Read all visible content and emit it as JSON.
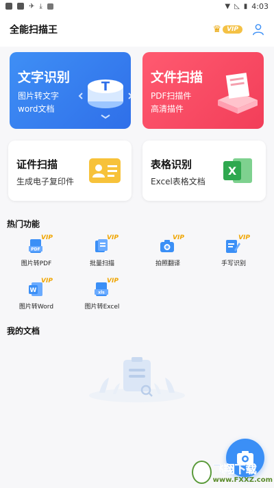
{
  "status": {
    "time": "4:03"
  },
  "app": {
    "title": "全能扫描王",
    "vip_label": "VIP"
  },
  "cards": {
    "text_recognition": {
      "title": "文字识别",
      "line1": "图片转文字",
      "line2": "word文档"
    },
    "file_scan": {
      "title": "文件扫描",
      "line1": "PDF扫描件",
      "line2": "高清描件"
    },
    "id_scan": {
      "title": "证件扫描",
      "subtitle": "生成电子复印件"
    },
    "table_recognition": {
      "title": "表格识别",
      "subtitle": "Excel表格文档"
    }
  },
  "hot": {
    "title": "热门功能",
    "items": [
      {
        "label": "图片转PDF",
        "vip": "VIP",
        "icon": "pdf-icon"
      },
      {
        "label": "批量扫描",
        "vip": "VIP",
        "icon": "batch-scan-icon"
      },
      {
        "label": "拍照翻译",
        "vip": "VIP",
        "icon": "camera-translate-icon"
      },
      {
        "label": "手写识别",
        "vip": "VIP",
        "icon": "handwriting-icon"
      },
      {
        "label": "图片转Word",
        "vip": "VIP",
        "icon": "word-icon"
      },
      {
        "label": "图片转Excel",
        "vip": "VIP",
        "icon": "excel-icon"
      }
    ]
  },
  "docs": {
    "title": "我的文档"
  },
  "watermark": {
    "main": "飞翔下载",
    "sub": "www.FXXZ.com"
  },
  "colors": {
    "primary": "#3b8ff6",
    "red": "#f23e59",
    "vip": "#f0a500"
  }
}
